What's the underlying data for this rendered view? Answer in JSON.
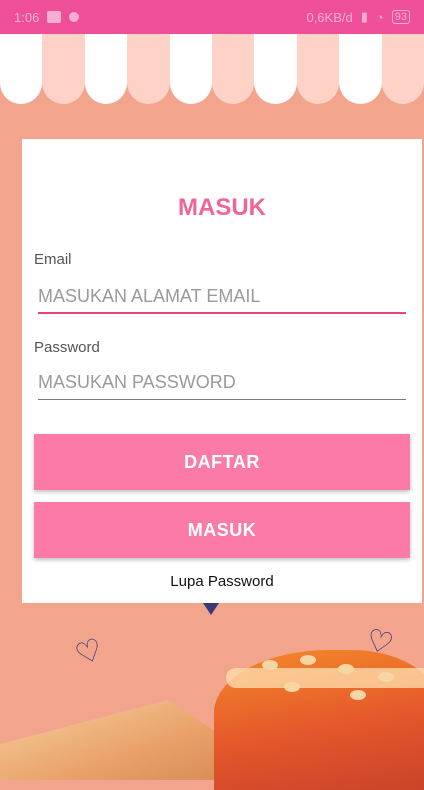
{
  "status_bar": {
    "time": "1:06",
    "network_speed": "0,6KB/d",
    "battery": "93"
  },
  "login": {
    "title": "MASUK",
    "email_label": "Email",
    "email_placeholder": "MASUKAN ALAMAT EMAIL",
    "password_label": "Password",
    "password_placeholder": "MASUKAN PASSWORD",
    "register_button": "DAFTAR",
    "login_button": "MASUK",
    "forgot_password": "Lupa Password"
  },
  "colors": {
    "status_bar": "#ef4f98",
    "background": "#f2a48d",
    "title": "#f0649e",
    "button": "#fb7aa8",
    "input_focus_line": "#e0457f"
  },
  "icons": [
    "notification-icon",
    "wifi-icon",
    "signal-icon",
    "battery-icon"
  ]
}
